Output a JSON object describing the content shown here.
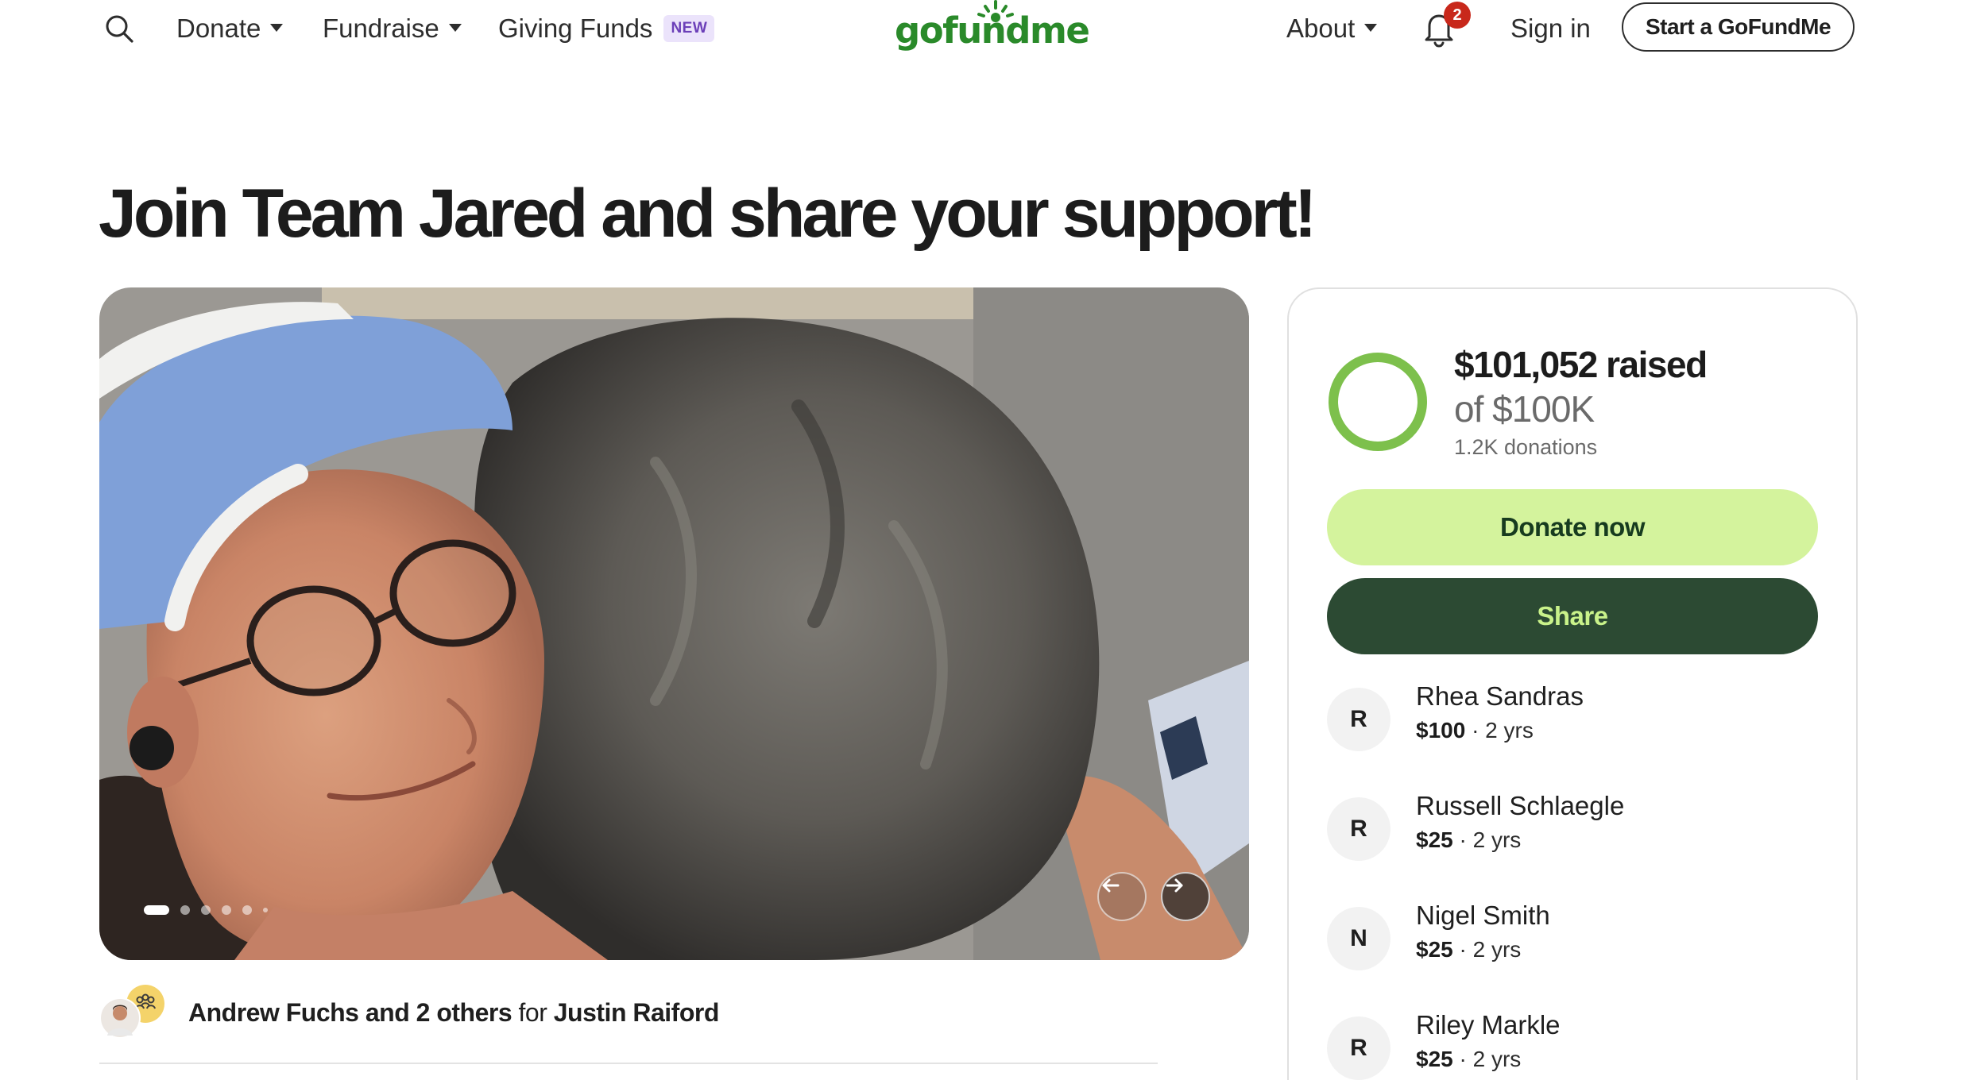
{
  "nav": {
    "donate": "Donate",
    "fundraise": "Fundraise",
    "giving_funds": "Giving Funds",
    "new_badge": "NEW",
    "about": "About",
    "notifications_count": "2",
    "sign_in": "Sign in",
    "start_button": "Start a GoFundMe"
  },
  "logo": {
    "text": "gofundme"
  },
  "page": {
    "title": "Join Team Jared and share your support!"
  },
  "carousel": {
    "slide_count": 6,
    "active_index": 0
  },
  "organizer": {
    "names": "Andrew Fuchs and 2 others",
    "for_word": "for",
    "beneficiary": "Justin Raiford"
  },
  "fundraiser": {
    "raised": "$101,052 raised",
    "goal": "of $100K",
    "donations": "1.2K donations",
    "progress_fraction": 1.0,
    "donate_button": "Donate now",
    "share_button": "Share"
  },
  "donors": [
    {
      "initial": "R",
      "name": "Rhea Sandras",
      "amount": "$100",
      "time": "· 2 yrs"
    },
    {
      "initial": "R",
      "name": "Russell Schlaegle",
      "amount": "$25",
      "time": "· 2 yrs"
    },
    {
      "initial": "N",
      "name": "Nigel Smith",
      "amount": "$25",
      "time": "· 2 yrs"
    },
    {
      "initial": "R",
      "name": "Riley Markle",
      "amount": "$25",
      "time": "· 2 yrs"
    }
  ],
  "colors": {
    "brand_green": "#2a8a2a",
    "donate_bg": "#d4f39d",
    "share_bg": "#2c4a33",
    "progress_green": "#7dc04c",
    "notification_red": "#c8281b"
  }
}
